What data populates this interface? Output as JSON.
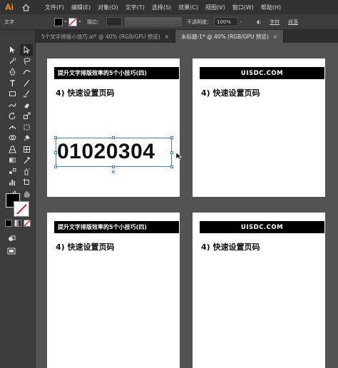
{
  "app": {
    "logo": "Ai"
  },
  "menu": [
    "文件(F)",
    "编辑(E)",
    "对象(O)",
    "文字(T)",
    "选择(S)",
    "效果(C)",
    "视图(V)",
    "窗口(W)",
    "帮助(H)"
  ],
  "control_bar": {
    "selection_label": "文字",
    "stroke_label": "描边：",
    "opacity_label": "不透明度：",
    "opacity_value": "100%",
    "char_label": "字符",
    "para_label": "段落",
    "fill_color": "#000000",
    "stroke_color": "#ff0000"
  },
  "tabs": [
    {
      "label": "5个文字排版小技巧.ai* @ 40% (RGB/GPU 预览)",
      "close": "×",
      "active": false
    },
    {
      "label": "未标题-1* @ 40% (RGB/GPU 预览)",
      "close": "×",
      "active": true
    }
  ],
  "artboards": [
    {
      "banner": "提升文字排版效率的5个小技巧(四)",
      "subhead": "4) 快速设置页码",
      "page_number": "01020304",
      "selected": true
    },
    {
      "banner": "UISDC.COM",
      "subhead": "4) 快速设置页码",
      "selected": false
    },
    {
      "banner": "提升文字排版效率的5个小技巧(四)",
      "subhead": "4) 快速设置页码",
      "selected": false
    },
    {
      "banner": "UISDC.COM",
      "subhead": "4) 快速设置页码",
      "selected": false
    }
  ],
  "colors": {
    "accent_selection": "#3a7ddc",
    "app_orange": "#ff9a00"
  }
}
